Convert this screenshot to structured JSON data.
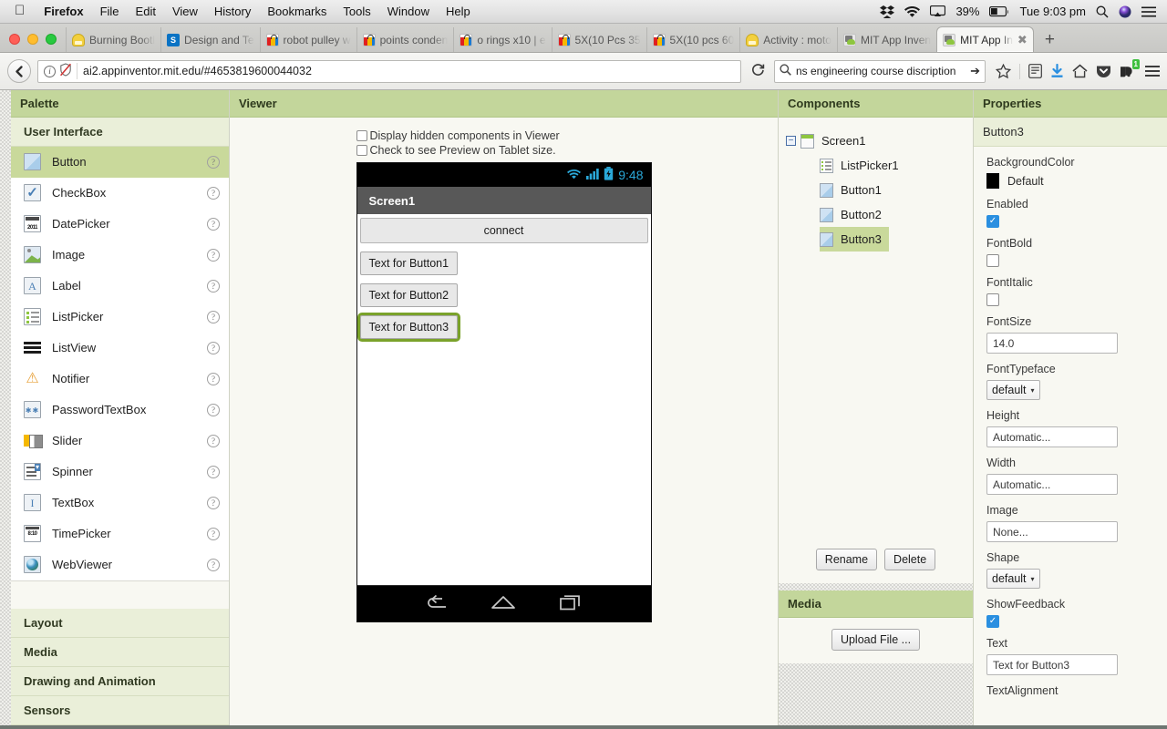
{
  "mac_menu": {
    "apple_icon": "apple-logo",
    "items": [
      "Firefox",
      "File",
      "Edit",
      "View",
      "History",
      "Bookmarks",
      "Tools",
      "Window",
      "Help"
    ],
    "status_icons": [
      "dropbox-icon",
      "wifi-icon",
      "airplay-icon",
      "battery-icon",
      "spotlight-search-icon",
      "siri-icon",
      "notification-center-icon"
    ],
    "battery_percent": "39%",
    "clock": "Tue 9:03 pm"
  },
  "browser": {
    "window_controls": [
      "close-button",
      "minimize-button",
      "maximize-button"
    ],
    "tabs": [
      {
        "title": "Burning Bootl",
        "favicon": "hardhat-icon",
        "active": false
      },
      {
        "title": "Design and Te",
        "favicon": "sharepoint-icon",
        "active": false
      },
      {
        "title": "robot pulley w",
        "favicon": "shopping-bag-icon",
        "active": false
      },
      {
        "title": "points conden",
        "favicon": "shopping-bag-icon",
        "active": false
      },
      {
        "title": "o rings x10 | e",
        "favicon": "shopping-bag-icon",
        "active": false
      },
      {
        "title": "5X(10 Pcs 35",
        "favicon": "shopping-bag-icon",
        "active": false
      },
      {
        "title": "5X(10 pcs 60",
        "favicon": "shopping-bag-icon",
        "active": false
      },
      {
        "title": "Activity : moto",
        "favicon": "hardhat-icon",
        "active": false
      },
      {
        "title": "MIT App Inven",
        "favicon": "app-inventor-icon",
        "active": false
      },
      {
        "title": "MIT App In",
        "favicon": "app-inventor-icon",
        "active": true
      }
    ],
    "new_tab_label": "+",
    "close_tab_label": "✖",
    "nav": {
      "back_label": "❮",
      "reload_label": "⟳",
      "url": "ai2.appinventor.mit.edu/#4653819600044032",
      "identity_icons": [
        "page-info-icon",
        "tracking-protection-icon"
      ],
      "search_value": "ns engineering course discription",
      "search_go_label": "➔",
      "search_icon": "search-icon",
      "toolbar_icons": [
        "bookmark-star-icon",
        "reader-list-icon",
        "downloads-icon",
        "home-icon",
        "pocket-icon",
        "dropbox-extension-icon",
        "hamburger-menu-icon"
      ],
      "dropbox_badge": "1"
    }
  },
  "palette": {
    "header": "Palette",
    "sections": [
      {
        "label": "User Interface",
        "open": true
      },
      {
        "label": "Layout",
        "open": false
      },
      {
        "label": "Media",
        "open": false
      },
      {
        "label": "Drawing and Animation",
        "open": false
      },
      {
        "label": "Sensors",
        "open": false
      }
    ],
    "help_label": "?",
    "items": [
      {
        "label": "Button",
        "icon": "button-icon",
        "selected": true
      },
      {
        "label": "CheckBox",
        "icon": "checkbox-icon",
        "selected": false
      },
      {
        "label": "DatePicker",
        "icon": "datepicker-icon",
        "selected": false
      },
      {
        "label": "Image",
        "icon": "image-icon",
        "selected": false
      },
      {
        "label": "Label",
        "icon": "label-icon",
        "selected": false
      },
      {
        "label": "ListPicker",
        "icon": "listpicker-icon",
        "selected": false
      },
      {
        "label": "ListView",
        "icon": "listview-icon",
        "selected": false
      },
      {
        "label": "Notifier",
        "icon": "notifier-icon",
        "selected": false
      },
      {
        "label": "PasswordTextBox",
        "icon": "password-textbox-icon",
        "selected": false
      },
      {
        "label": "Slider",
        "icon": "slider-icon",
        "selected": false
      },
      {
        "label": "Spinner",
        "icon": "spinner-icon",
        "selected": false
      },
      {
        "label": "TextBox",
        "icon": "textbox-icon",
        "selected": false
      },
      {
        "label": "TimePicker",
        "icon": "timepicker-icon",
        "selected": false
      },
      {
        "label": "WebViewer",
        "icon": "webviewer-icon",
        "selected": false
      }
    ]
  },
  "viewer": {
    "header": "Viewer",
    "checkbox_hidden_components": "Display hidden components in Viewer",
    "checkbox_tablet_preview": "Check to see Preview on Tablet size.",
    "phone": {
      "status_time": "9:48",
      "status_icons": [
        "wifi-icon",
        "signal-icon",
        "battery-charging-icon"
      ],
      "title": "Screen1",
      "listpicker_label": "connect",
      "buttons": [
        {
          "label": "Text for Button1",
          "selected": false
        },
        {
          "label": "Text for Button2",
          "selected": false
        },
        {
          "label": "Text for Button3",
          "selected": true
        }
      ],
      "nav_icons": [
        "back-icon",
        "home-icon",
        "recents-icon"
      ]
    }
  },
  "components": {
    "header": "Components",
    "tree": [
      {
        "label": "Screen1",
        "icon": "screen-icon",
        "depth": 0,
        "selected": false,
        "twisty": "−"
      },
      {
        "label": "ListPicker1",
        "icon": "listpicker-icon",
        "depth": 1,
        "selected": false
      },
      {
        "label": "Button1",
        "icon": "button-icon",
        "depth": 1,
        "selected": false
      },
      {
        "label": "Button2",
        "icon": "button-icon",
        "depth": 1,
        "selected": false
      },
      {
        "label": "Button3",
        "icon": "button-icon",
        "depth": 1,
        "selected": true
      }
    ],
    "rename_label": "Rename",
    "delete_label": "Delete"
  },
  "media": {
    "header": "Media",
    "upload_label": "Upload File ..."
  },
  "properties": {
    "header": "Properties",
    "selected_component": "Button3",
    "fields": [
      {
        "label": "BackgroundColor",
        "type": "color",
        "value": "Default",
        "swatch": "#000000"
      },
      {
        "label": "Enabled",
        "type": "checkbox",
        "checked": true
      },
      {
        "label": "FontBold",
        "type": "checkbox",
        "checked": false
      },
      {
        "label": "FontItalic",
        "type": "checkbox",
        "checked": false
      },
      {
        "label": "FontSize",
        "type": "input",
        "value": "14.0"
      },
      {
        "label": "FontTypeface",
        "type": "select",
        "value": "default"
      },
      {
        "label": "Height",
        "type": "input",
        "value": "Automatic..."
      },
      {
        "label": "Width",
        "type": "input",
        "value": "Automatic..."
      },
      {
        "label": "Image",
        "type": "input",
        "value": "None..."
      },
      {
        "label": "Shape",
        "type": "select",
        "value": "default"
      },
      {
        "label": "ShowFeedback",
        "type": "checkbox",
        "checked": true
      },
      {
        "label": "Text",
        "type": "input",
        "value": "Text for Button3"
      },
      {
        "label": "TextAlignment",
        "type": "label_only"
      }
    ],
    "check_glyph": "✓",
    "caret_glyph": "▾"
  },
  "colors": {
    "panel_header": "#c3d69b",
    "panel_subheader": "#eaefd9",
    "selection": "#c9d99b",
    "selection_outline": "#7aa22a",
    "panel_bg": "#f8f8f2",
    "desktop": "#6e7671",
    "phone_title_bar": "#585858",
    "phone_status_text": "#2aa8d8",
    "checkbox_on": "#2a8fe0"
  }
}
